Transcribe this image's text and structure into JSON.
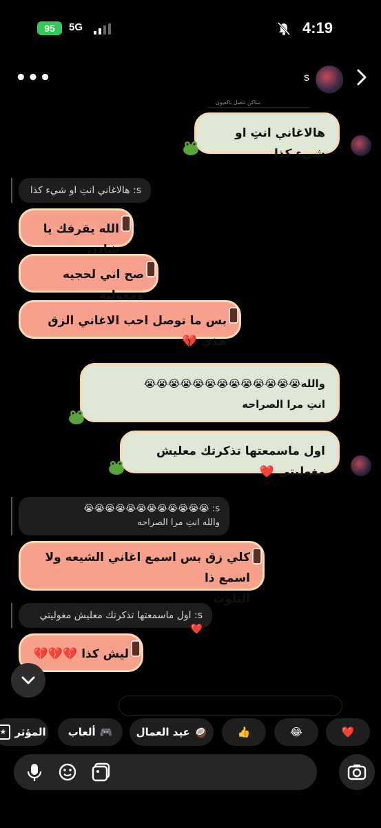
{
  "status": {
    "time": "4:19",
    "battery": "95",
    "network": "5G"
  },
  "header": {
    "name": "s",
    "subtitle": "ساكن تتصل بالعيون"
  },
  "messages": [
    {
      "text": "هالاغاني انتِ او شيء كذا"
    },
    {
      "reply": "s: هالاغاني انتِ او شيء كذا"
    },
    {
      "text": "الله يقرفك يا شادن"
    },
    {
      "text": "صح اني لحجيه ومغوليه"
    },
    {
      "text": "بس ما توصل احب الاغاني الزق هذي"
    },
    {
      "text": "والله😭😭😭😭😭😭😭😭😭😭😭😭😭",
      "text2": "انتِ مرا الصراحه"
    },
    {
      "text": "اول ماسمعتها تذكرتك معليش مغوليتي"
    },
    {
      "reply": "s: 😭😭😭😭😭😭😭😭😭😭😭😭",
      "reply2": "والله انتِ مرا الصراحه"
    },
    {
      "text": "كلي زق بس اسمع اغاني الشيعه ولا اسمع ذا",
      "text2": "التلوث"
    },
    {
      "reply": "s: اول ماسمعتها تذكرتك معليش مغوليتي"
    },
    {
      "text": "ليش كذا"
    }
  ],
  "chips": [
    {
      "label": "المؤثر"
    },
    {
      "label": "ألعاب"
    },
    {
      "label": "عيد العمال"
    }
  ],
  "colors": {
    "sent_bg": "#dfe8d6",
    "recv_bg": "#f7a18c",
    "heart": "#e0162b"
  },
  "icons": [
    "mic-icon",
    "sticker-icon",
    "gallery-icon",
    "camera-icon",
    "chevron-down-icon",
    "back-arrow-icon",
    "more-icon"
  ]
}
